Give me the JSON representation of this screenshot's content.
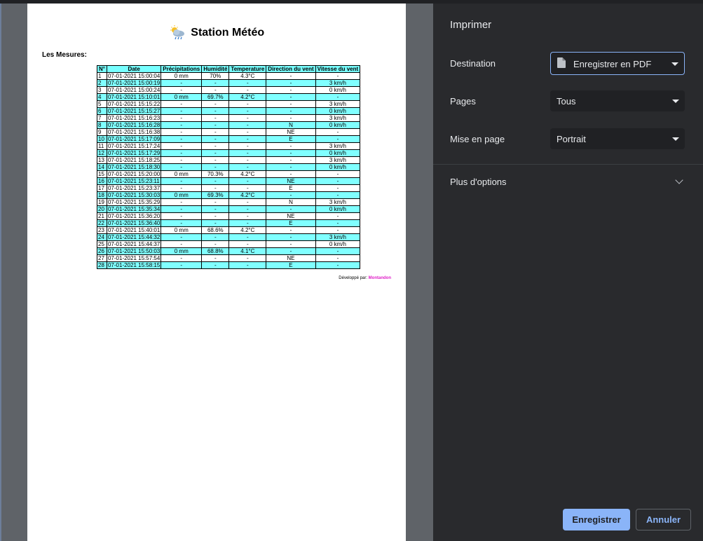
{
  "preview": {
    "page_title": "Station Météo",
    "mesures_label": "Les Mesures:",
    "table": {
      "headers": [
        "N°",
        "Date",
        "Précipitations",
        "Humidité",
        "Temperature",
        "Direction du vent",
        "Vitesse du vent"
      ],
      "rows": [
        [
          "1",
          "07-01-2021 15:00:04",
          "0 mm",
          "70%",
          "4.3°C",
          "-",
          "-"
        ],
        [
          "2",
          "07-01-2021 15:00:19",
          "-",
          "-",
          "-",
          "-",
          "3 km/h"
        ],
        [
          "3",
          "07-01-2021 15:00:24",
          "-",
          "-",
          "-",
          "-",
          "0 km/h"
        ],
        [
          "4",
          "07-01-2021 15:10:01",
          "0 mm",
          "69.7%",
          "4.2°C",
          "-",
          "-"
        ],
        [
          "5",
          "07-01-2021 15:15:22",
          "-",
          "-",
          "-",
          "-",
          "3 km/h"
        ],
        [
          "6",
          "07-01-2021 15:15:27",
          "-",
          "-",
          "-",
          "-",
          "0 km/h"
        ],
        [
          "7",
          "07-01-2021 15:16:23",
          "-",
          "-",
          "-",
          "-",
          "3 km/h"
        ],
        [
          "8",
          "07-01-2021 15:16:28",
          "-",
          "-",
          "-",
          "N",
          "0 km/h"
        ],
        [
          "9",
          "07-01-2021 15:16:38",
          "-",
          "-",
          "-",
          "NE",
          "-"
        ],
        [
          "10",
          "07-01-2021 15:17:09",
          "-",
          "-",
          "-",
          "E",
          "-"
        ],
        [
          "11",
          "07-01-2021 15:17:24",
          "-",
          "-",
          "-",
          "-",
          "3 km/h"
        ],
        [
          "12",
          "07-01-2021 15:17:29",
          "-",
          "-",
          "-",
          "-",
          "0 km/h"
        ],
        [
          "13",
          "07-01-2021 15:18:25",
          "-",
          "-",
          "-",
          "-",
          "3 km/h"
        ],
        [
          "14",
          "07-01-2021 15:18:30",
          "-",
          "-",
          "-",
          "-",
          "0 km/h"
        ],
        [
          "15",
          "07-01-2021 15:20:00",
          "0 mm",
          "70.3%",
          "4.2°C",
          "-",
          "-"
        ],
        [
          "16",
          "07-01-2021 15:23:11",
          "-",
          "-",
          "-",
          "NE",
          "-"
        ],
        [
          "17",
          "07-01-2021 15:23:37",
          "-",
          "-",
          "-",
          "E",
          "-"
        ],
        [
          "18",
          "07-01-2021 15:30:03",
          "0 mm",
          "69.3%",
          "4.2°C",
          "-",
          "-"
        ],
        [
          "19",
          "07-01-2021 15:35:29",
          "-",
          "-",
          "-",
          "N",
          "3 km/h"
        ],
        [
          "20",
          "07-01-2021 15:35:34",
          "-",
          "-",
          "-",
          "-",
          "0 km/h"
        ],
        [
          "21",
          "07-01-2021 15:36:20",
          "-",
          "-",
          "-",
          "NE",
          "-"
        ],
        [
          "22",
          "07-01-2021 15:36:40",
          "-",
          "-",
          "-",
          "E",
          "-"
        ],
        [
          "23",
          "07-01-2021 15:40:01",
          "0 mm",
          "68.6%",
          "4.2°C",
          "-",
          "-"
        ],
        [
          "24",
          "07-01-2021 15:44:32",
          "-",
          "-",
          "-",
          "-",
          "3 km/h"
        ],
        [
          "25",
          "07-01-2021 15:44:37",
          "-",
          "-",
          "-",
          "-",
          "0 km/h"
        ],
        [
          "26",
          "07-01-2021 15:50:03",
          "0 mm",
          "68.8%",
          "4.1°C",
          "-",
          "-"
        ],
        [
          "27",
          "07-01-2021 15:57:54",
          "-",
          "-",
          "-",
          "NE",
          "-"
        ],
        [
          "28",
          "07-01-2021 15:58:15",
          "-",
          "-",
          "-",
          "E",
          "-"
        ]
      ]
    },
    "credit_prefix": "Développé par:",
    "credit_author": "Montandon",
    "row_highlight_color": "#80ffff",
    "author_color": "#e020c8"
  },
  "panel": {
    "title": "Imprimer",
    "destination_label": "Destination",
    "destination_value": "Enregistrer en PDF",
    "destination_icon": "file-icon",
    "pages_label": "Pages",
    "pages_value": "Tous",
    "layout_label": "Mise en page",
    "layout_value": "Portrait",
    "more_options_label": "Plus d'options",
    "save_label": "Enregistrer",
    "cancel_label": "Annuler",
    "accent_color": "#8ab4f8"
  }
}
